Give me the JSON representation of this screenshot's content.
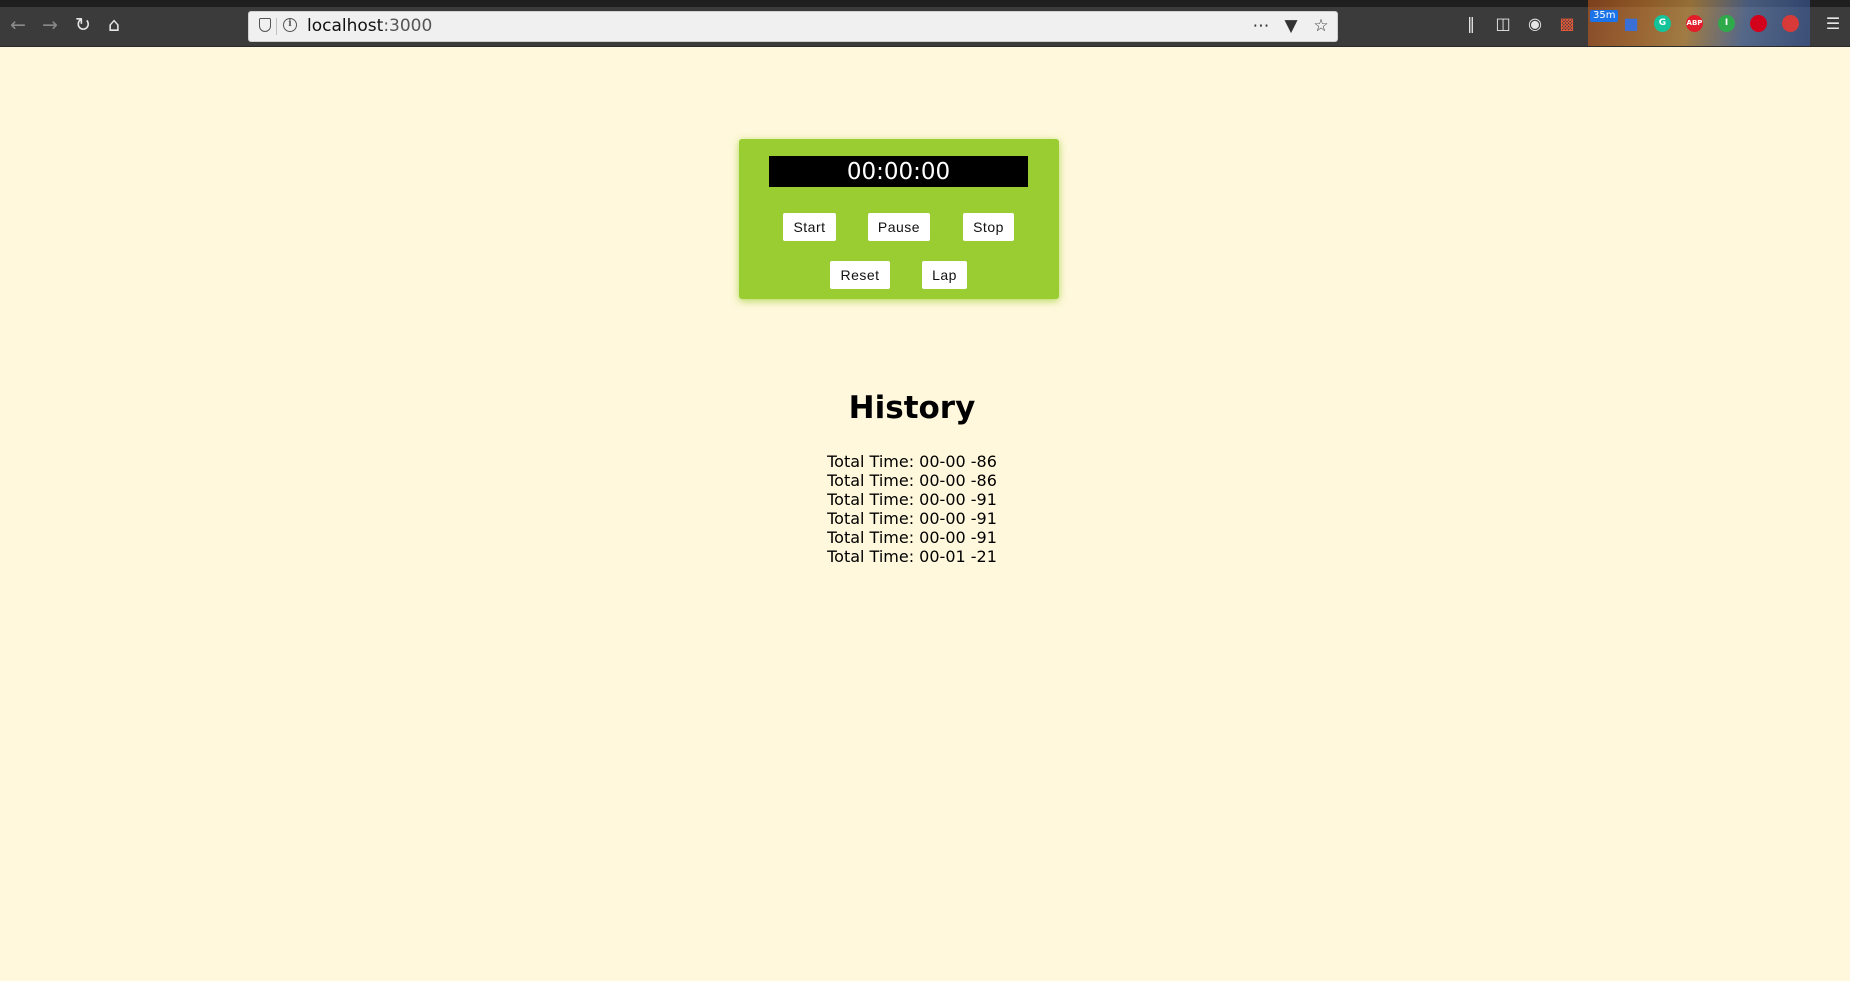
{
  "browser": {
    "url_host": "localhost",
    "url_port": ":3000",
    "extension_badge": "35m",
    "extensions": [
      {
        "name": "grammarly-icon",
        "label": "G",
        "color": "#15c39a"
      },
      {
        "name": "adblock-icon",
        "label": "ABP",
        "color": "#e21e2a"
      },
      {
        "name": "extension-green-icon",
        "label": "I",
        "color": "#2eaa4a"
      },
      {
        "name": "extension-red-icon",
        "label": "",
        "color": "#d2001a"
      }
    ]
  },
  "stopwatch": {
    "display": "00:00:00",
    "buttons": {
      "start": "Start",
      "pause": "Pause",
      "stop": "Stop",
      "reset": "Reset",
      "lap": "Lap"
    },
    "background_color": "#9acd32"
  },
  "history": {
    "title": "History",
    "entries": [
      "Total Time: 00-00 -86",
      "Total Time: 00-00 -86",
      "Total Time: 00-00 -91",
      "Total Time: 00-00 -91",
      "Total Time: 00-00 -91",
      "Total Time: 00-01 -21"
    ]
  },
  "page": {
    "background_color": "#fff8dc"
  }
}
